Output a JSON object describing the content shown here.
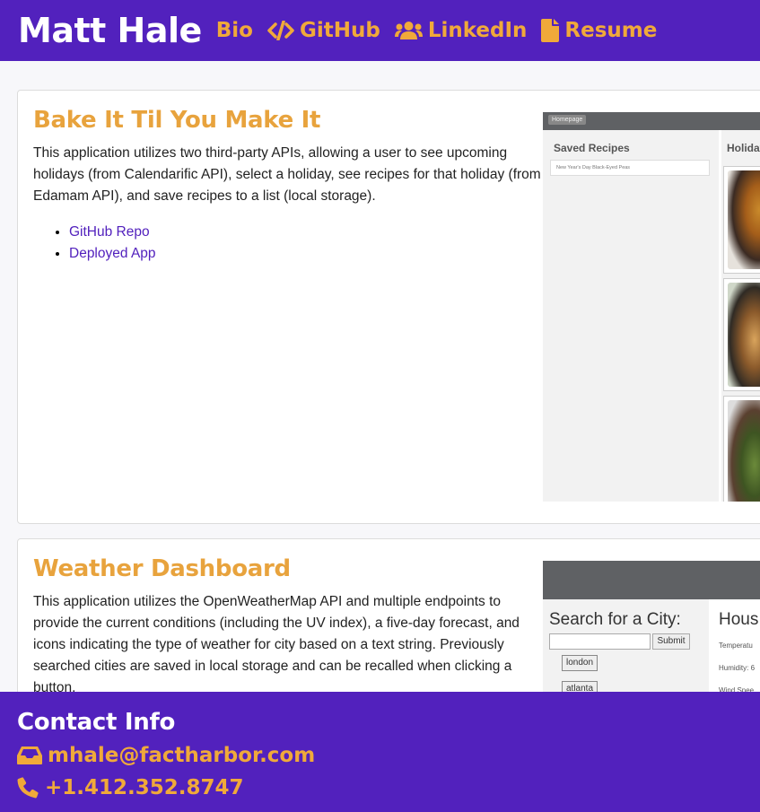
{
  "nav": {
    "brand": "Matt Hale",
    "links": [
      {
        "label": "Bio",
        "icon": "none"
      },
      {
        "label": "GitHub",
        "icon": "code-icon"
      },
      {
        "label": "LinkedIn",
        "icon": "users-icon"
      },
      {
        "label": "Resume",
        "icon": "file-icon"
      }
    ]
  },
  "projects": [
    {
      "title": "Bake It Til You Make It",
      "description": "This application utilizes two third-party APIs, allowing a user to see upcoming holidays (from Calendarific API), select a holiday, see recipes for that holiday (from Edamam API), and save recipes to a list (local storage).",
      "links": [
        "GitHub Repo",
        "Deployed App"
      ],
      "screenshot": {
        "home_button": "Homepage",
        "saved_title": "Saved Recipes",
        "saved_item": "New Year's Day Black-Eyed Peas",
        "holidays_title": "Holiday"
      }
    },
    {
      "title": "Weather Dashboard",
      "description": "This application utilizes the OpenWeatherMap API and multiple endpoints to provide the current conditions (including the UV index), a five-day forecast, and icons indicating the type of weather for city based on a text string. Previously searched cities are saved in local storage and can be recalled when clicking a button.",
      "screenshot": {
        "search_title": "Search for a City:",
        "submit_label": "Submit",
        "cities": [
          "london",
          "atlanta"
        ],
        "city_name": "Hous",
        "stats": [
          "Temperatu",
          "Humidity: 6",
          "Wind Spee"
        ]
      }
    }
  ],
  "footer": {
    "title": "Contact Info",
    "email": "mhale@factharbor.com",
    "phone": "+1.412.352.8747"
  },
  "colors": {
    "primary": "#5221bd",
    "accent": "#f0a93a",
    "title_accent": "#e8a33d"
  }
}
